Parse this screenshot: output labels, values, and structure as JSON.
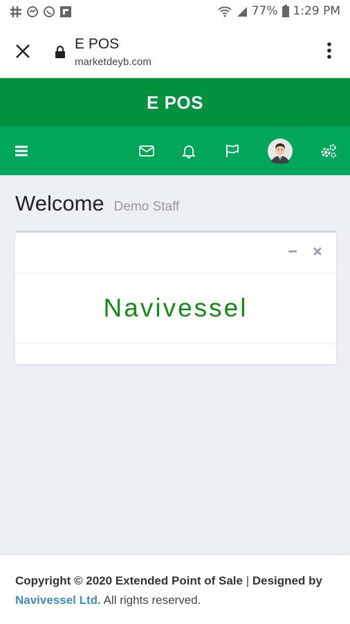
{
  "status_bar": {
    "battery": "77%",
    "time": "1:29 PM",
    "icons": [
      "slack-icon",
      "messenger-icon",
      "whatsapp-icon",
      "flipboard-icon",
      "wifi-icon",
      "signal-icon",
      "battery-icon"
    ]
  },
  "browser": {
    "page_title": "E POS",
    "domain": "marketdeyb.com",
    "icons": [
      "close-icon",
      "lock-icon",
      "more-vert-icon"
    ]
  },
  "header": {
    "title": "E POS"
  },
  "navbar": {
    "icons": [
      "hamburger-icon",
      "envelope-icon",
      "bell-icon",
      "flag-icon",
      "user-avatar",
      "cogs-icon"
    ]
  },
  "content": {
    "welcome": "Welcome",
    "user": "Demo Staff",
    "brand": "Navivessel",
    "box_tools": [
      "minus-icon",
      "times-icon"
    ]
  },
  "footer": {
    "copyright": "Copyright © 2020 Extended Point of Sale",
    "separator": "|",
    "designed": "Designed",
    "by": "by",
    "company": "Navivessel Ltd.",
    "rights": "All rights reserved."
  },
  "colors": {
    "header": "#00923f",
    "navbar": "#00a65a",
    "brand": "#158a16",
    "link": "#3c8dbc",
    "background": "#ecf0f5"
  }
}
